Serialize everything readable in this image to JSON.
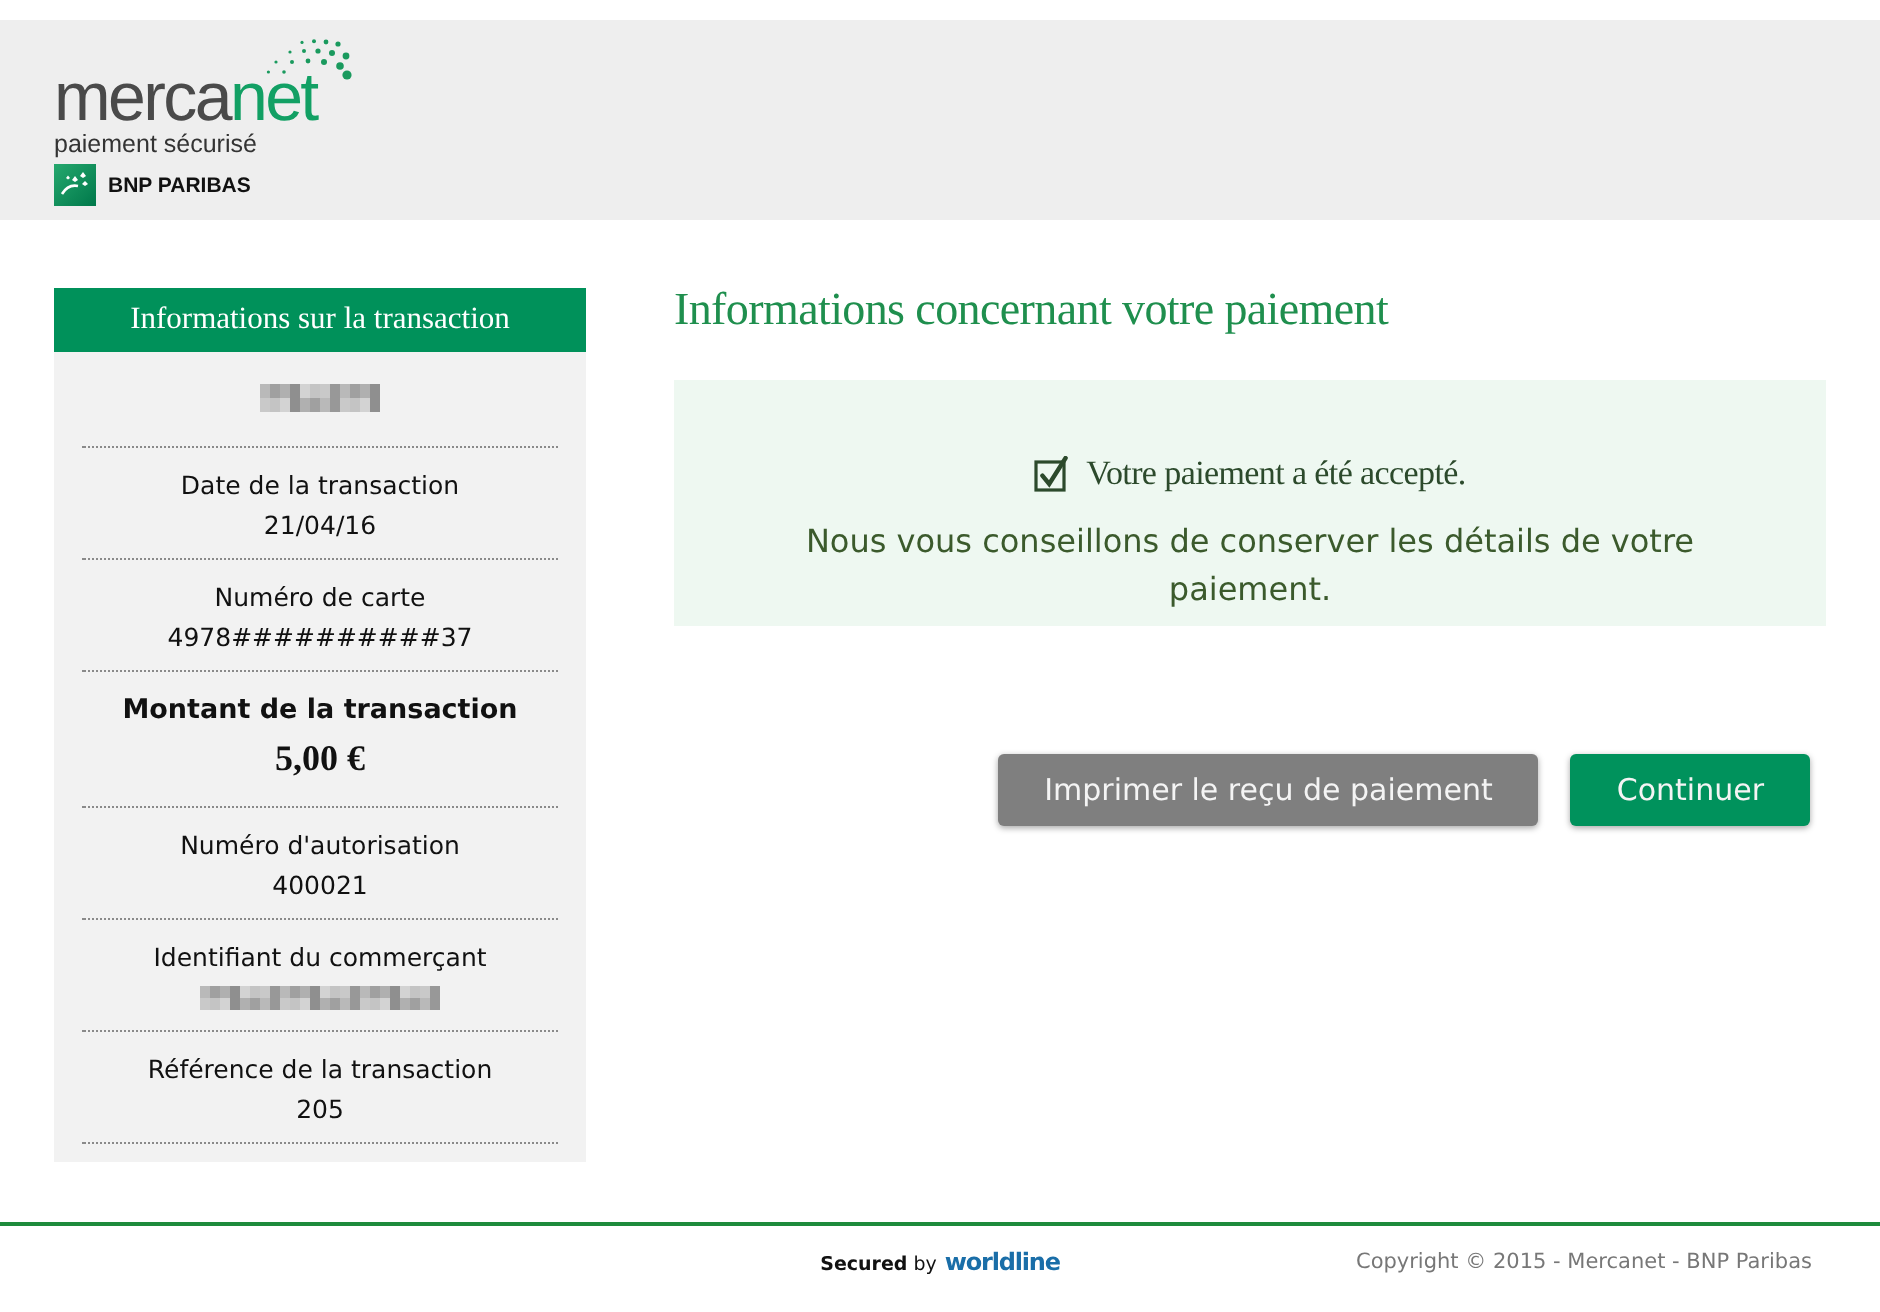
{
  "header": {
    "logo": {
      "word_start": "merca",
      "word_end": "net",
      "tagline": "paiement sécurisé",
      "bank": "BNP PARIBAS"
    }
  },
  "sidebar": {
    "title": "Informations sur la transaction",
    "items": [
      {
        "kind": "field",
        "redacted": true
      },
      {
        "kind": "field",
        "label": "Date de la transaction",
        "value": "21/04/16",
        "redacted": false
      },
      {
        "kind": "field",
        "label": "Numéro de carte",
        "value": "4978##########37",
        "redacted": false
      },
      {
        "kind": "amount",
        "label": "Montant de la transaction",
        "value": "5,00 €",
        "redacted": false
      },
      {
        "kind": "field",
        "label": "Numéro d'autorisation",
        "value": "400021",
        "redacted": false
      },
      {
        "kind": "field",
        "label": "Identifiant du commerçant",
        "redacted": true
      },
      {
        "kind": "field",
        "label": "Référence de la transaction",
        "value": "205",
        "redacted": false
      }
    ]
  },
  "main": {
    "title": "Informations concernant votre paiement",
    "notice": {
      "checked": true,
      "status": "Votre paiement a été accepté.",
      "advice": "Nous vous conseillons de conserver les détails de votre paiement."
    },
    "buttons": [
      {
        "label": "Imprimer le reçu de paiement",
        "kind": "secondary"
      },
      {
        "label": "Continuer",
        "kind": "primary"
      }
    ]
  },
  "footer": {
    "secured": "**Secured** by",
    "brand": "worldline",
    "copyright": "Copyright © 2015 - Mercanet - BNP Paribas"
  }
}
